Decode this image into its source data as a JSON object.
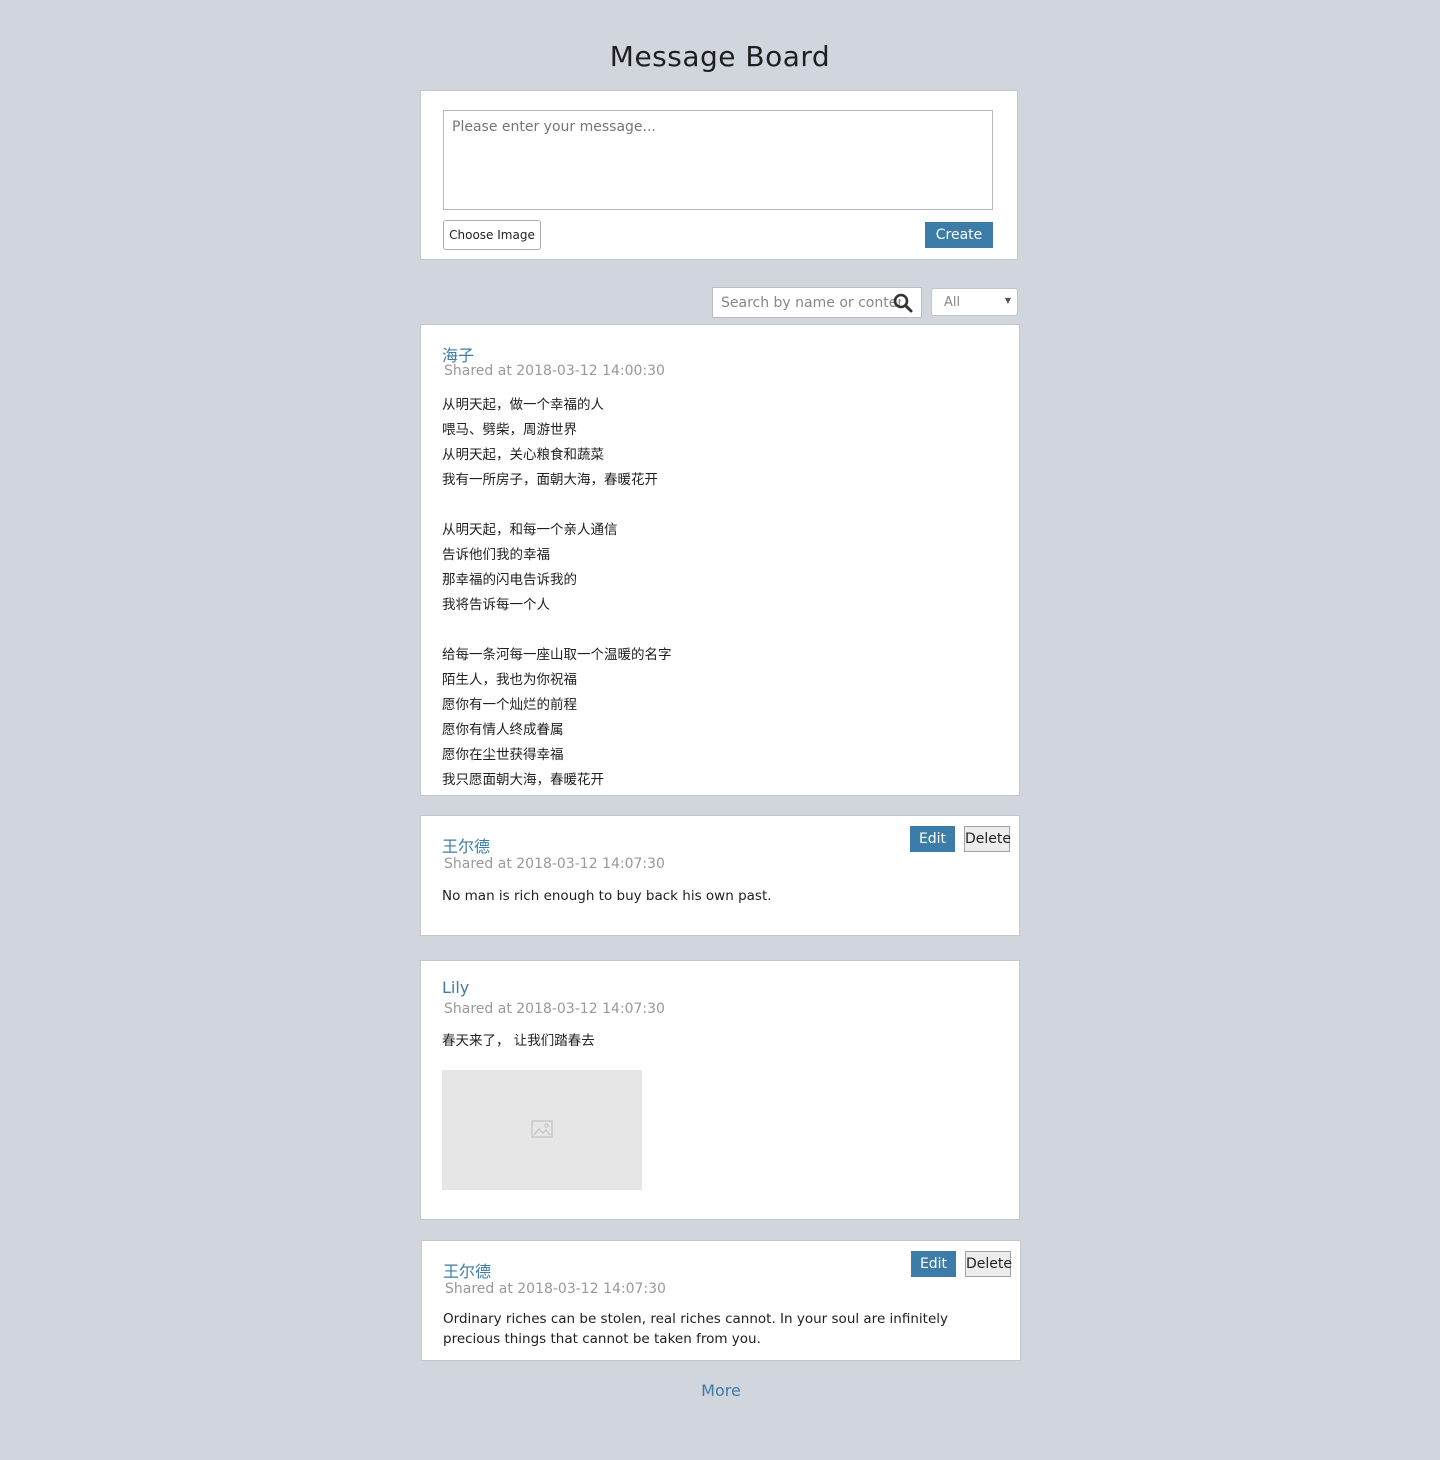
{
  "page": {
    "title": "Message Board"
  },
  "composer": {
    "placeholder": "Please enter your message...",
    "choose_image_label": "Choose Image",
    "create_label": "Create"
  },
  "toolbar": {
    "search_placeholder": "Search by name or content",
    "filter_value": "All"
  },
  "messages": [
    {
      "author": "海子",
      "time": "Shared at 2018-03-12 14:00:30",
      "lines": [
        "从明天起，做一个幸福的人",
        "喂马、劈柴，周游世界",
        "从明天起，关心粮食和蔬菜",
        "我有一所房子，面朝大海，春暖花开",
        "",
        "从明天起，和每一个亲人通信",
        "告诉他们我的幸福",
        "那幸福的闪电告诉我的",
        "我将告诉每一个人",
        "",
        "给每一条河每一座山取一个温暖的名字",
        "陌生人，我也为你祝福",
        "愿你有一个灿烂的前程",
        "愿你有情人终成眷属",
        "愿你在尘世获得幸福",
        "我只愿面朝大海，春暖花开"
      ]
    },
    {
      "author": "王尔德",
      "time": "Shared at 2018-03-12 14:07:30",
      "text": "No man is rich enough to buy back his own past.",
      "edit_label": "Edit",
      "delete_label": "Delete"
    },
    {
      "author": "Lily",
      "time": "Shared at 2018-03-12 14:07:30",
      "text": "春天来了， 让我们踏春去"
    },
    {
      "author": "王尔德",
      "time": "Shared at 2018-03-12 14:07:30",
      "text": "Ordinary riches can be stolen, real riches cannot. In your soul are infinitely precious things that cannot be taken from you.",
      "edit_label": "Edit",
      "delete_label": "Delete"
    }
  ],
  "more_label": "More",
  "colors": {
    "accent": "#3b7ca8",
    "background": "#d1d6de"
  }
}
